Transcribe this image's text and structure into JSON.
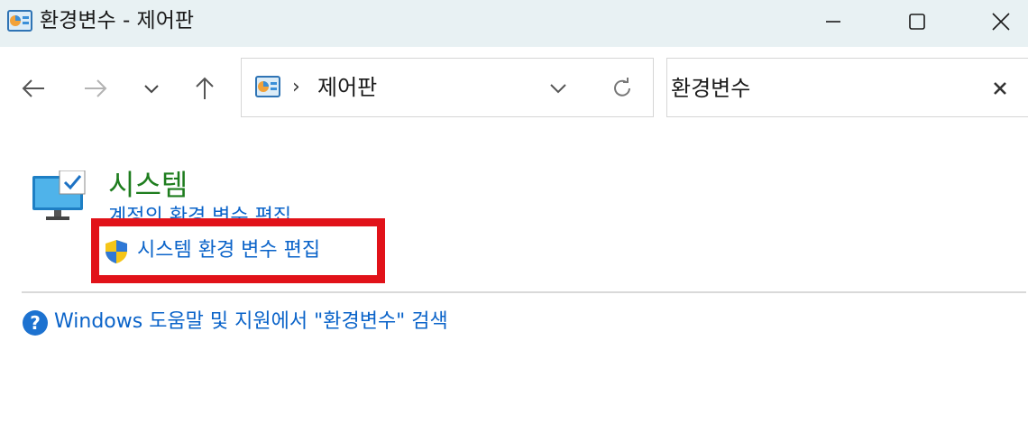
{
  "window": {
    "title": "환경변수 - 제어판",
    "icon": "control-panel-icon",
    "buttons": [
      "minimize-icon",
      "maximize-icon",
      "close-icon"
    ]
  },
  "navigation": {
    "buttons": [
      "back-arrow-icon",
      "forward-arrow-icon",
      "recent-locations-chevron-icon",
      "up-arrow-icon"
    ],
    "address": {
      "icon": "control-panel-icon",
      "separator": "›",
      "crumb": "제어판"
    },
    "search": {
      "value": "환경변수"
    }
  },
  "results": {
    "category": {
      "icon": "system-monitor-icon",
      "title": "시스템",
      "links": [
        {
          "label": "계정의 환경 변수 편집",
          "shield": false
        },
        {
          "label": "시스템 환경 변수 편집",
          "shield": true,
          "highlighted": true
        }
      ]
    },
    "help": {
      "icon": "help-question-icon",
      "label": "Windows 도움말 및 지원에서 \"환경변수\" 검색"
    }
  },
  "colors": {
    "titlebar": "#e8f1f3",
    "heading": "#1e7d1e",
    "link": "#0a63c9",
    "highlight": "#e11219"
  }
}
